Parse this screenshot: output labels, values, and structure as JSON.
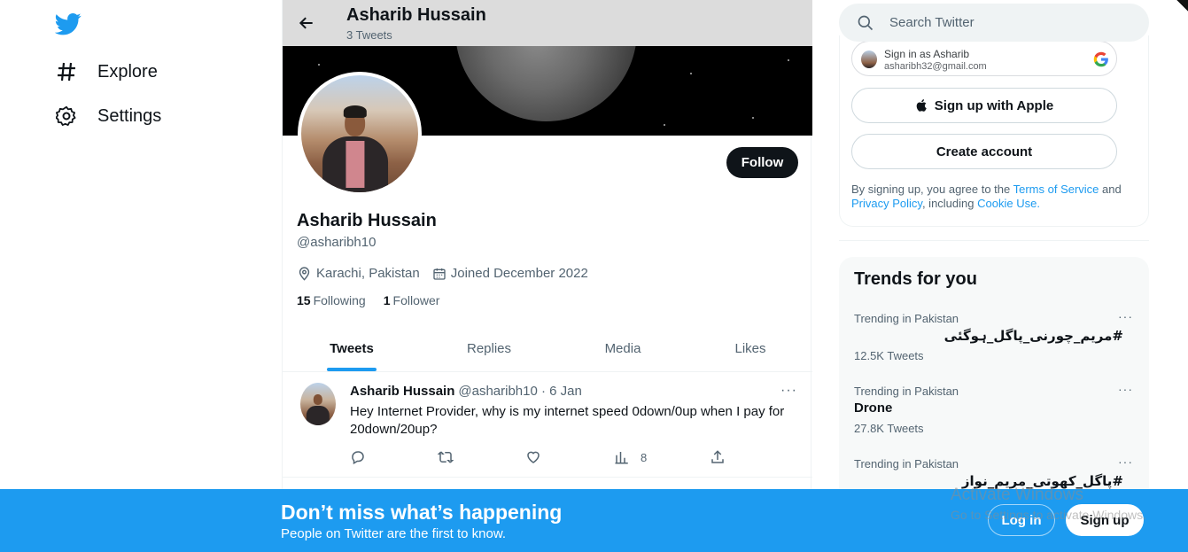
{
  "nav": {
    "items": [
      {
        "label": "Explore",
        "icon": "hashtag-icon"
      },
      {
        "label": "Settings",
        "icon": "gear-icon"
      }
    ]
  },
  "header": {
    "name": "Asharib Hussain",
    "tweet_count": "3 Tweets"
  },
  "profile": {
    "name": "Asharib Hussain",
    "handle": "@asharibh10",
    "location": "Karachi, Pakistan",
    "joined": "Joined December 2022",
    "following_count": "15",
    "following_label": "Following",
    "followers_count": "1",
    "followers_label": "Follower",
    "follow_button": "Follow"
  },
  "tabs": [
    {
      "label": "Tweets",
      "active": true
    },
    {
      "label": "Replies",
      "active": false
    },
    {
      "label": "Media",
      "active": false
    },
    {
      "label": "Likes",
      "active": false
    }
  ],
  "tweet": {
    "author": "Asharib Hussain",
    "meta": "@asharibh10 · 6 Jan",
    "text": "Hey Internet Provider, why is my internet speed 0down/0up when I pay for 20down/20up?",
    "views": "8",
    "more": "···"
  },
  "search": {
    "placeholder": "Search Twitter"
  },
  "signup": {
    "google_line1": "Sign in as Asharib",
    "google_line2": "asharibh32@gmail.com",
    "apple_label": "Sign up with Apple",
    "create_label": "Create account",
    "legal_prefix": "By signing up, you agree to the ",
    "terms": "Terms of Service",
    "legal_and": " and ",
    "privacy": "Privacy Policy",
    "legal_including": ", including ",
    "cookie": "Cookie Use",
    "legal_end": "."
  },
  "trends": {
    "title": "Trends for you",
    "items": [
      {
        "context": "Trending in Pakistan",
        "name": "#مریم_چورنی_پاگل_ہوگئی",
        "count": "12.5K Tweets"
      },
      {
        "context": "Trending in Pakistan",
        "name": "Drone",
        "count": "27.8K Tweets"
      },
      {
        "context": "Trending in Pakistan",
        "name": "#پاگل_کھوتی_مریم_نواز",
        "count": ""
      }
    ]
  },
  "bottom_bar": {
    "title": "Don’t miss what’s happening",
    "subtitle": "People on Twitter are the first to know.",
    "login": "Log in",
    "signup": "Sign up"
  },
  "watermark": {
    "line1": "Activate Windows",
    "line2": "Go to Settings to activate Windows."
  },
  "colors": {
    "accent": "#1d9bf0",
    "text": "#0f1419",
    "secondary": "#536471"
  }
}
